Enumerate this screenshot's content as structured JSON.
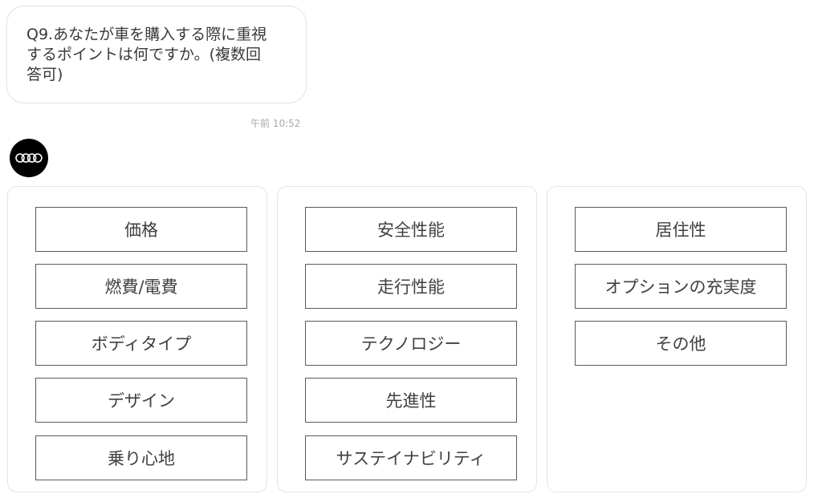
{
  "question": {
    "text": "Q9.あなたが車を購入する際に重視\nするポイントは何ですか。(複数回\n答可)",
    "timestamp": "午前 10:52"
  },
  "bot": {
    "avatar_icon": "four-rings-logo-icon",
    "avatar_bg": "#000000"
  },
  "columns": [
    {
      "options": [
        "価格",
        "燃費/電費",
        "ボディタイプ",
        "デザイン",
        "乗り心地"
      ]
    },
    {
      "options": [
        "安全性能",
        "走行性能",
        "テクノロジー",
        "先進性",
        "サステイナビリティ"
      ]
    },
    {
      "options": [
        "居住性",
        "オプションの充実度",
        "その他"
      ]
    }
  ]
}
